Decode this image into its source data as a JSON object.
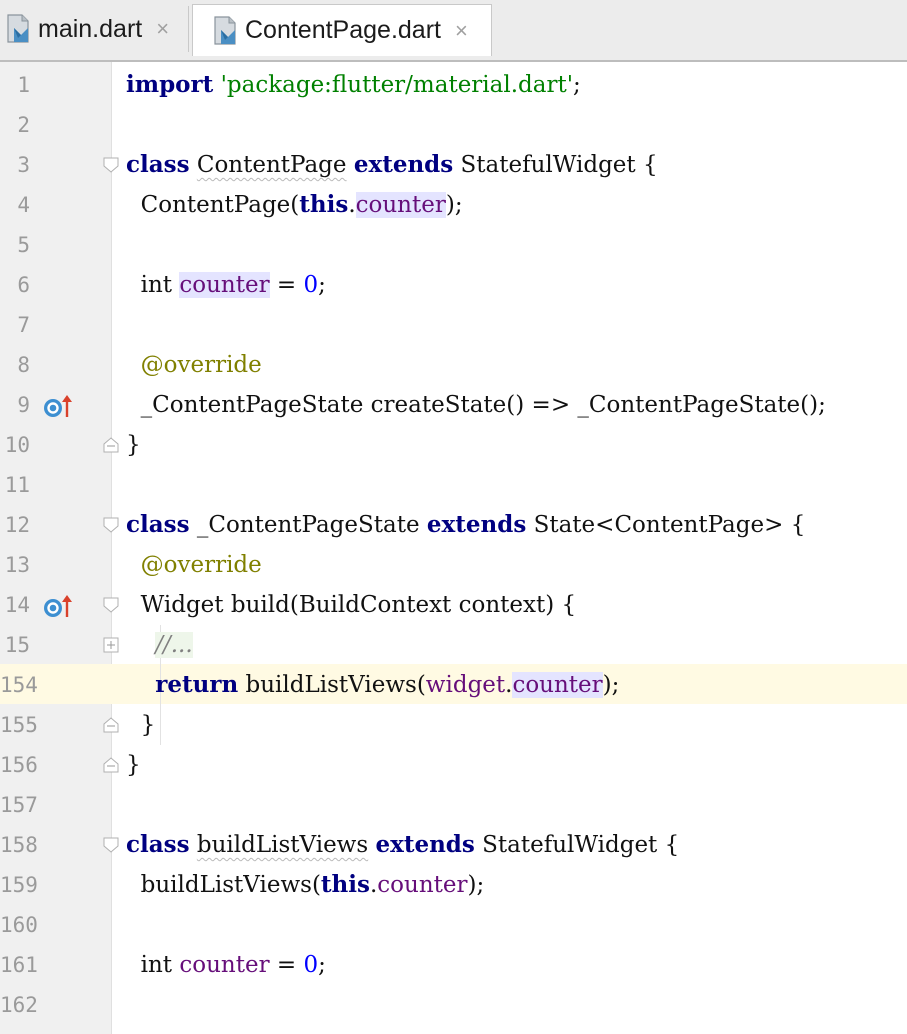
{
  "tabs": [
    {
      "label": "main.dart",
      "active": false
    },
    {
      "label": "ContentPage.dart",
      "active": true
    }
  ],
  "close_glyph": "×",
  "editor": {
    "language": "dart",
    "current_line": "154",
    "lines": [
      {
        "num": "1",
        "text": "import 'package:flutter/material.dart';"
      },
      {
        "num": "2",
        "text": ""
      },
      {
        "num": "3",
        "text": "class ContentPage extends StatefulWidget {"
      },
      {
        "num": "4",
        "text": "  ContentPage(this.counter);"
      },
      {
        "num": "5",
        "text": ""
      },
      {
        "num": "6",
        "text": "  int counter = 0;"
      },
      {
        "num": "7",
        "text": ""
      },
      {
        "num": "8",
        "text": "  @override"
      },
      {
        "num": "9",
        "text": "  _ContentPageState createState() => _ContentPageState();"
      },
      {
        "num": "10",
        "text": "}"
      },
      {
        "num": "11",
        "text": ""
      },
      {
        "num": "12",
        "text": "class _ContentPageState extends State<ContentPage> {"
      },
      {
        "num": "13",
        "text": "  @override"
      },
      {
        "num": "14",
        "text": "  Widget build(BuildContext context) {"
      },
      {
        "num": "15",
        "text": "    //..."
      },
      {
        "num": "154",
        "text": "    return buildListViews(widget.counter);"
      },
      {
        "num": "155",
        "text": "  }"
      },
      {
        "num": "156",
        "text": "}"
      },
      {
        "num": "157",
        "text": ""
      },
      {
        "num": "158",
        "text": "class buildListViews extends StatefulWidget {"
      },
      {
        "num": "159",
        "text": "  buildListViews(this.counter);"
      },
      {
        "num": "160",
        "text": ""
      },
      {
        "num": "161",
        "text": "  int counter = 0;"
      },
      {
        "num": "162",
        "text": ""
      }
    ]
  },
  "tokens": {
    "import": "import",
    "class": "class",
    "extends": "extends",
    "this": "this",
    "return": "return",
    "widget": "widget",
    "override": "@override",
    "pkg": "'package:flutter/material.dart'",
    "ContentPage": "ContentPage",
    "StatefulWidget": "StatefulWidget",
    "ContentPageState": "_ContentPageState",
    "State": "State",
    "Widget": "Widget",
    "build": "build",
    "BuildContext": "BuildContext",
    "context": "context",
    "buildListViews": "buildListViews",
    "counter": "counter",
    "int": "int",
    "zero": "0",
    "createState": "createState",
    "folded_comment": "//..."
  },
  "colors": {
    "keyword": "#000080",
    "string": "#008000",
    "number": "#0000ff",
    "field": "#660e7a",
    "annotation": "#808000",
    "comment": "#808080",
    "current_line": "#fffae3",
    "usage_highlight": "#e4e4ff",
    "override_arrow": "#d9412b",
    "override_circle": "#3d8fd1"
  },
  "icons": {
    "file_icon": "dart-file-icon",
    "override_marker": "overrides-method-icon",
    "fold_open": "fold-collapse-icon",
    "fold_closed": "fold-expand-icon"
  }
}
